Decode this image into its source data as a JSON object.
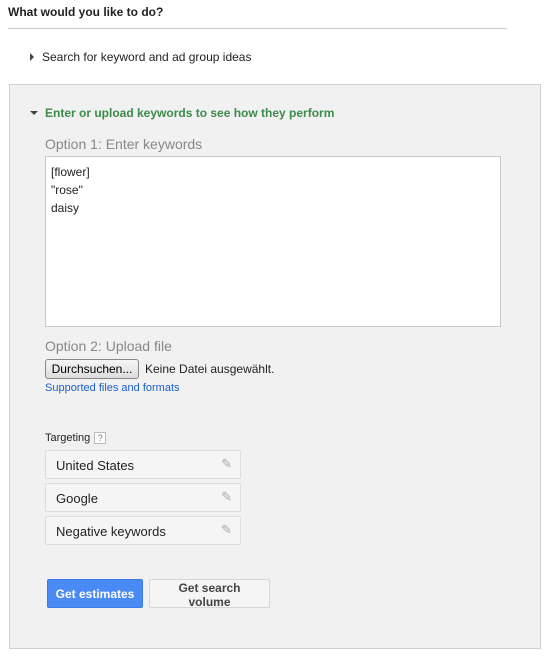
{
  "title": "What would you like to do?",
  "collapsed_option": "Search for keyword and ad group ideas",
  "section": {
    "title": "Enter or upload keywords to see how they perform",
    "option1_label": "Option 1: Enter keywords",
    "keywords_value": "[flower]\n\"rose\"\ndaisy",
    "option2_label": "Option 2: Upload file",
    "browse_label": "Durchsuchen...",
    "no_file": "Keine Datei ausgewählt.",
    "supported_link": "Supported files and formats",
    "targeting_label": "Targeting",
    "help": "?",
    "targeting": [
      {
        "label": "United States"
      },
      {
        "label": "Google"
      },
      {
        "label": "Negative keywords"
      }
    ],
    "get_estimates": "Get estimates",
    "get_search_volume": "Get search volume"
  },
  "colors": {
    "section_title": "#3d8b4a",
    "primary_button": "#4a8af4",
    "link": "#1a5fc8"
  }
}
